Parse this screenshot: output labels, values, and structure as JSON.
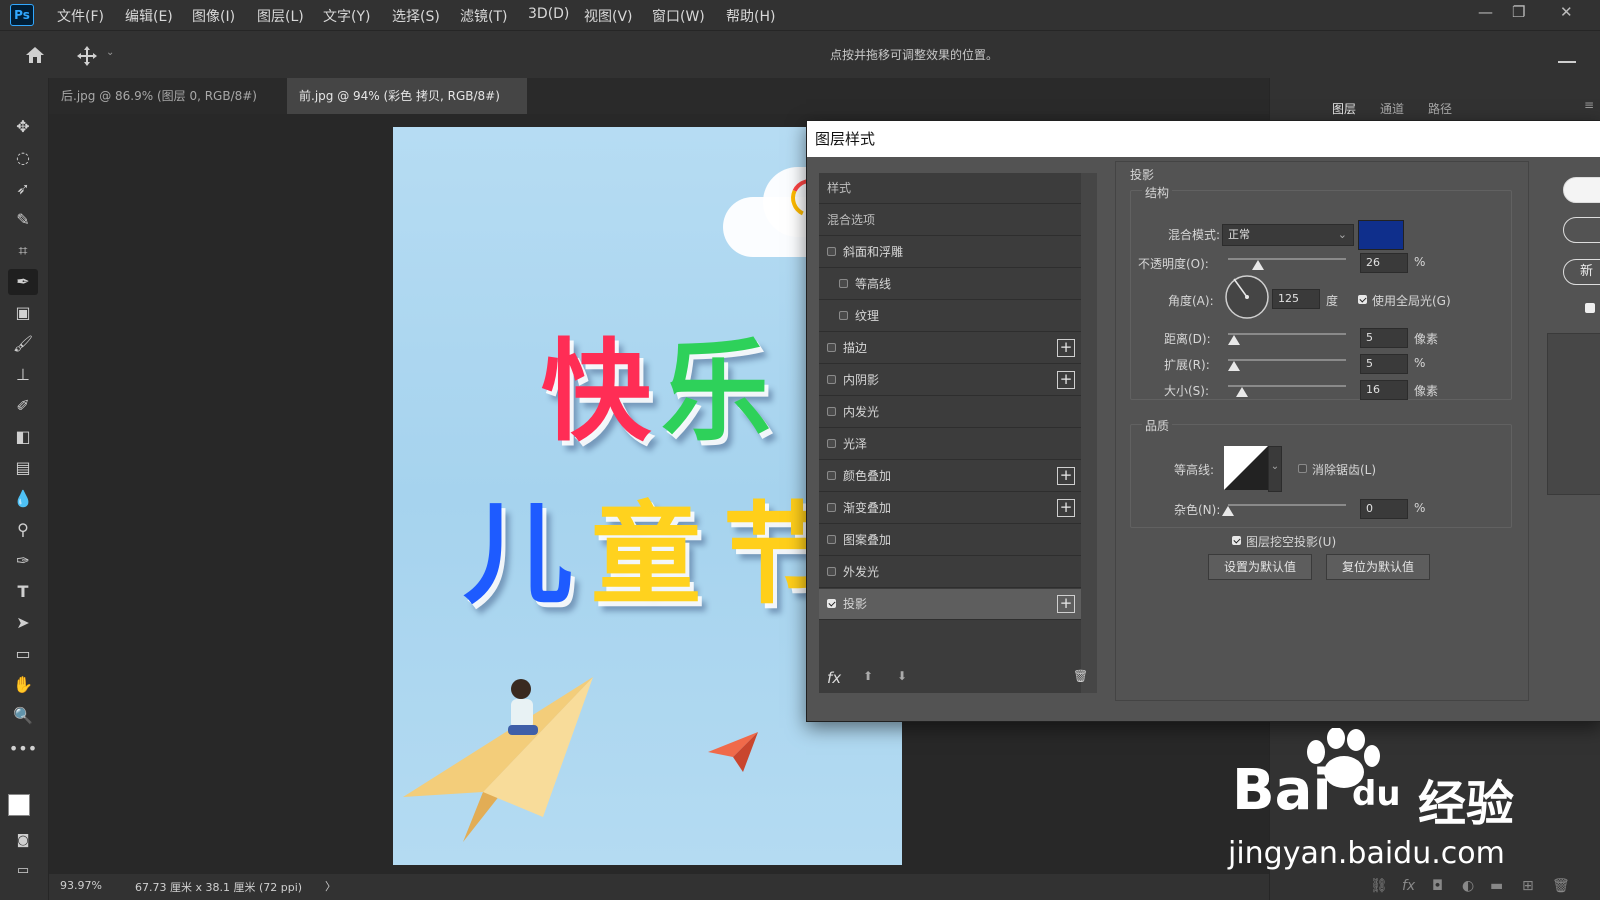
{
  "app": {
    "logo": "Ps"
  },
  "menu": [
    "文件(F)",
    "编辑(E)",
    "图像(I)",
    "图层(L)",
    "文字(Y)",
    "选择(S)",
    "滤镜(T)",
    "3D(D)",
    "视图(V)",
    "窗口(W)",
    "帮助(H)"
  ],
  "options": {
    "hint": "点按并拖移可调整效果的位置。"
  },
  "tabs": [
    {
      "label": "后.jpg @ 86.9% (图层 0, RGB/8#) *",
      "close": "×"
    },
    {
      "label": "前.jpg @ 94% (彩色 拷贝, RGB/8#) *",
      "close": "×"
    }
  ],
  "canvas": {
    "line1": [
      "快",
      "乐"
    ],
    "line2": [
      "儿",
      "童",
      "节"
    ]
  },
  "status": {
    "zoom": "93.97%",
    "size": "67.73 厘米 x 38.1 厘米 (72 ppi)",
    "arrow": "〉"
  },
  "panel": {
    "tabs": [
      "图层",
      "通道",
      "路径"
    ]
  },
  "dialog": {
    "title": "图层样式",
    "list_header": "样式",
    "blend_options": "混合选项",
    "styles": [
      {
        "label": "斜面和浮雕",
        "checked": false,
        "plus": false,
        "indent": false
      },
      {
        "label": "等高线",
        "checked": false,
        "plus": false,
        "indent": true
      },
      {
        "label": "纹理",
        "checked": false,
        "plus": false,
        "indent": true
      },
      {
        "label": "描边",
        "checked": false,
        "plus": true,
        "indent": false
      },
      {
        "label": "内阴影",
        "checked": false,
        "plus": true,
        "indent": false
      },
      {
        "label": "内发光",
        "checked": false,
        "plus": false,
        "indent": false
      },
      {
        "label": "光泽",
        "checked": false,
        "plus": false,
        "indent": false
      },
      {
        "label": "颜色叠加",
        "checked": false,
        "plus": true,
        "indent": false
      },
      {
        "label": "渐变叠加",
        "checked": false,
        "plus": true,
        "indent": false
      },
      {
        "label": "图案叠加",
        "checked": false,
        "plus": false,
        "indent": false
      },
      {
        "label": "外发光",
        "checked": false,
        "plus": false,
        "indent": false
      },
      {
        "label": "投影",
        "checked": true,
        "plus": true,
        "indent": false
      }
    ],
    "footer": {
      "fx": "fx"
    },
    "section_title": "投影",
    "structure": {
      "title": "结构",
      "blend_mode_label": "混合模式:",
      "blend_mode_value": "正常",
      "shadow_color": "#0f2f8c",
      "opacity_label": "不透明度(O):",
      "opacity_value": "26",
      "opacity_unit": "%",
      "angle_label": "角度(A):",
      "angle_value": "125",
      "angle_unit": "度",
      "global_light_label": "使用全局光(G)",
      "distance_label": "距离(D):",
      "distance_value": "5",
      "distance_unit": "像素",
      "spread_label": "扩展(R):",
      "spread_value": "5",
      "spread_unit": "%",
      "size_label": "大小(S):",
      "size_value": "16",
      "size_unit": "像素"
    },
    "quality": {
      "title": "品质",
      "contour_label": "等高线:",
      "antialias_label": "消除锯齿(L)",
      "noise_label": "杂色(N):",
      "noise_value": "0",
      "noise_unit": "%"
    },
    "knockout_label": "图层挖空投影(U)",
    "make_default": "设置为默认值",
    "reset_default": "复位为默认值",
    "side_button_partial": "新"
  },
  "watermark": {
    "brand": "Bai",
    "brand2": "du",
    "cn": "经验",
    "url": "jingyan.baidu.com"
  }
}
